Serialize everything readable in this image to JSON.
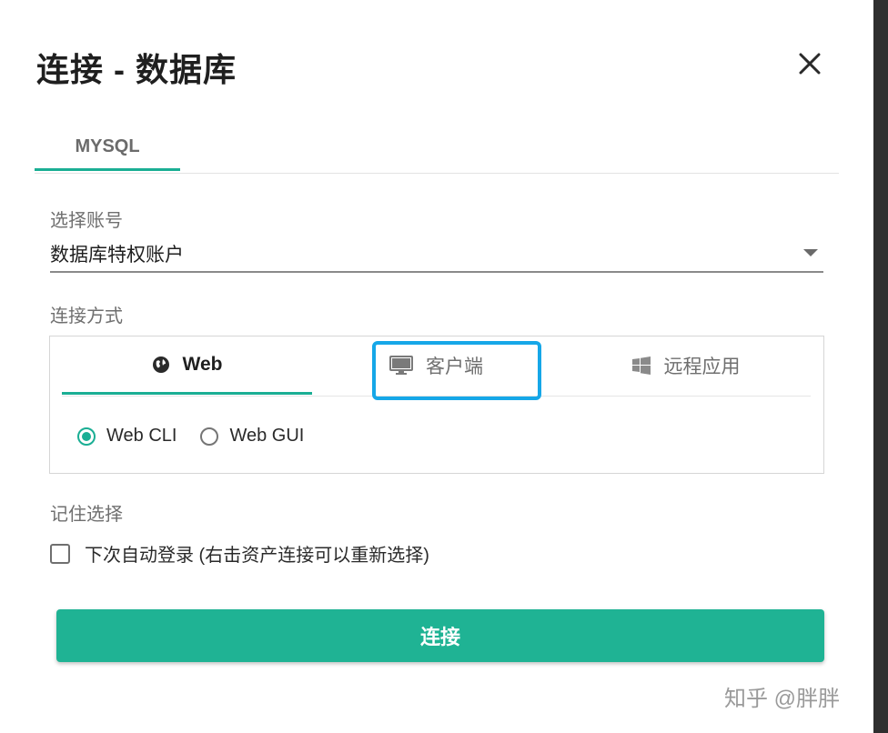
{
  "dialog": {
    "title": "连接 - 数据库",
    "close_icon": "close-icon"
  },
  "top_tabs": [
    {
      "label": "MYSQL",
      "active": true
    }
  ],
  "account": {
    "label": "选择账号",
    "value": "数据库特权账户"
  },
  "method": {
    "label": "连接方式",
    "tabs": [
      {
        "label": "Web",
        "icon": "globe-icon",
        "active": true
      },
      {
        "label": "客户端",
        "icon": "monitor-icon",
        "active": false
      },
      {
        "label": "远程应用",
        "icon": "windows-icon",
        "active": false
      }
    ],
    "options": [
      {
        "label": "Web CLI",
        "checked": true
      },
      {
        "label": "Web GUI",
        "checked": false
      }
    ]
  },
  "remember": {
    "label": "记住选择",
    "checkbox_label": "下次自动登录 (右击资产连接可以重新选择)",
    "checked": false
  },
  "connect_button": "连接",
  "watermark": "知乎 @胖胖",
  "colors": {
    "accent": "#1aae94",
    "highlight": "#16a7e8"
  }
}
